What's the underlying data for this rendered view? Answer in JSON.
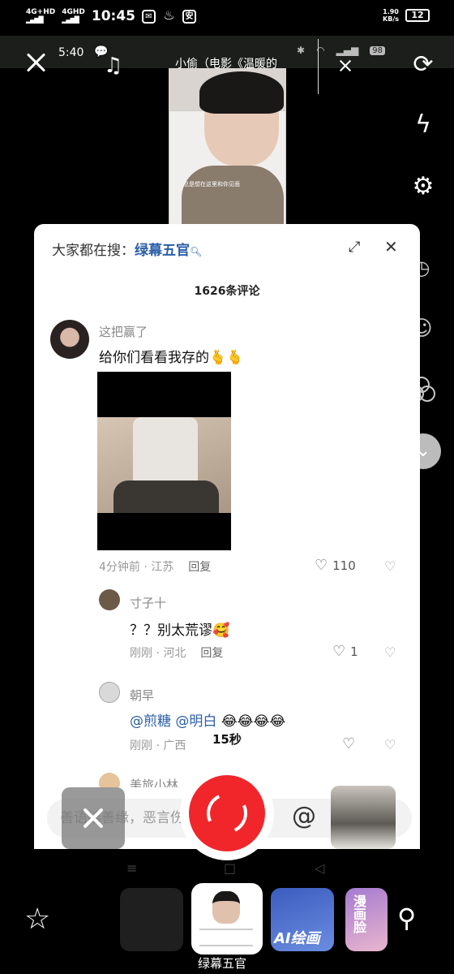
{
  "status_bar": {
    "network_1": "4G+HD",
    "network_2": "4GHD",
    "time": "10:45",
    "app_icon": "安",
    "speed_value": "1.90",
    "speed_unit": "KB/s",
    "battery": "12"
  },
  "recording_overlay": {
    "inner_time": "5:40",
    "inner_battery": "98",
    "video_title": "小偷（电影《温暖的",
    "thumb_caption": "总是想在这里和你见面"
  },
  "comments_sheet": {
    "search_prefix": "大家都在搜：",
    "search_term": "绿幕五官",
    "count_label": "1626条评论",
    "comments": [
      {
        "username": "这把赢了",
        "text": "给你们看看我存的🫰🫰",
        "meta": "4分钟前 · 江苏",
        "reply": "回复",
        "likes": "110"
      },
      {
        "username": "寸子十",
        "text": "？？别太荒谬🥰",
        "meta": "刚刚 · 河北",
        "reply": "回复",
        "likes": "1"
      },
      {
        "username": "朝早",
        "text_mention_1": "@煎糖",
        "text_mention_2": "@明白",
        "text_emoji": "😂😂😂😂",
        "meta": "刚刚 · 广西",
        "reply": ""
      },
      {
        "username": "美旅小林"
      }
    ],
    "input_placeholder": "善语结善缘，恶言伤人心"
  },
  "camera": {
    "recording_seconds": "15秒"
  },
  "template_strip": {
    "active_caption": "绿幕五官",
    "ai_label": "AI绘画",
    "manga_label": "漫画脸"
  },
  "icons": {
    "close": "close-icon",
    "music": "music-note-icon",
    "rotate": "camera-flip-icon",
    "flash": "flash-off-icon",
    "settings": "gear-icon",
    "timer": "timer-icon",
    "beauty": "beauty-face-icon",
    "filter": "filter-icon",
    "more": "chevron-down-icon",
    "star": "star-icon",
    "search": "search-icon"
  },
  "colors": {
    "record_red": "#f0262b",
    "link_blue": "#2a5ea8"
  }
}
